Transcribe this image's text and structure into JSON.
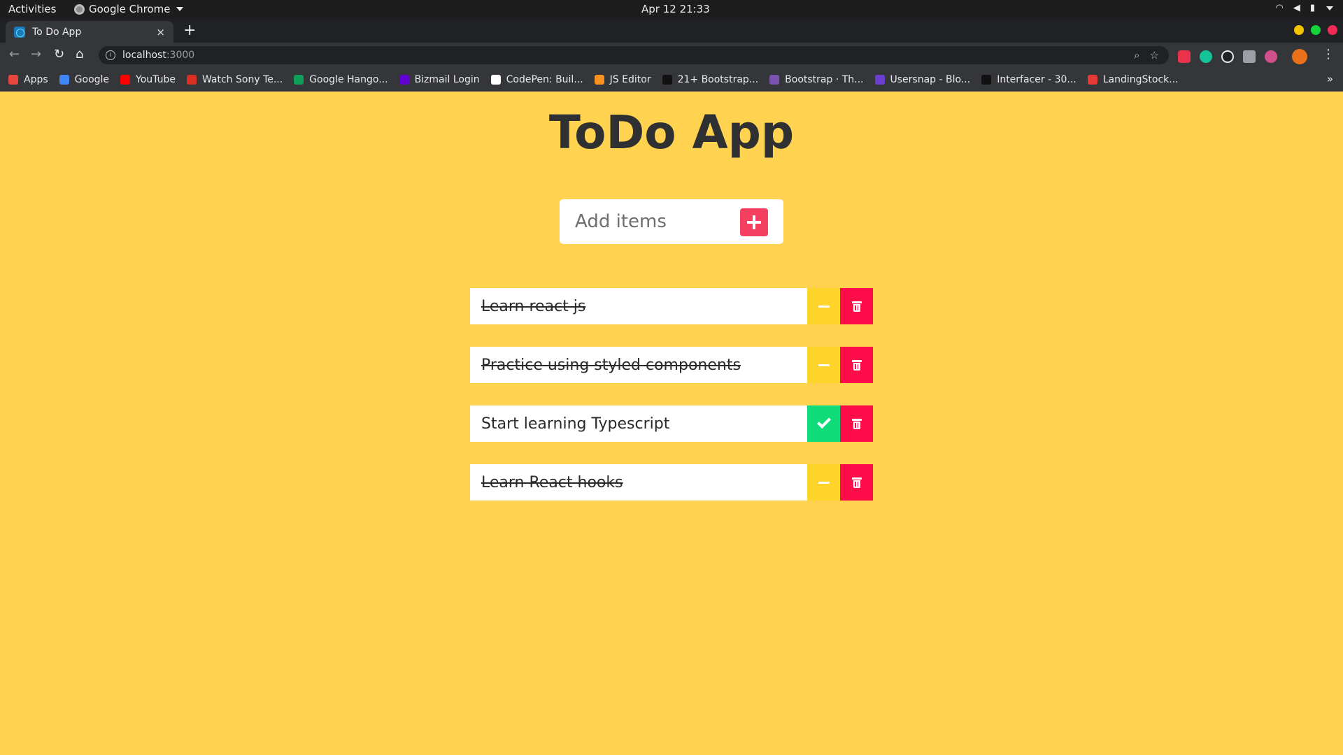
{
  "system_bar": {
    "activities": "Activities",
    "app_name": "Google Chrome",
    "clock": "Apr 12  21:33",
    "tray_icons": [
      "wifi-icon",
      "volume-icon",
      "battery-icon",
      "system-menu-caret-icon"
    ]
  },
  "browser": {
    "tab_title": "To Do App",
    "tab_close": "×",
    "new_tab": "+",
    "url_host": "localhost",
    "url_port": ":3000",
    "window_controls": {
      "minimize": "#f5c400",
      "maximize": "#16d33b",
      "close": "#f02c56"
    },
    "bookmarks": [
      {
        "label": "Apps",
        "color": "#e8453c"
      },
      {
        "label": "Google",
        "color": "#4285f4"
      },
      {
        "label": "YouTube",
        "color": "#ff0000"
      },
      {
        "label": "Watch Sony Te...",
        "color": "#d93025"
      },
      {
        "label": "Google Hango...",
        "color": "#0f9d58"
      },
      {
        "label": "Bizmail Login",
        "color": "#5f01d1"
      },
      {
        "label": "CodePen: Buil...",
        "color": "#ffffff"
      },
      {
        "label": "JS Editor",
        "color": "#f7931e"
      },
      {
        "label": "21+ Bootstrap...",
        "color": "#111111"
      },
      {
        "label": "Bootstrap · Th...",
        "color": "#7952b3"
      },
      {
        "label": "Usersnap - Blo...",
        "color": "#6c3fd1"
      },
      {
        "label": "Interfacer - 30...",
        "color": "#111111"
      },
      {
        "label": "LandingStock...",
        "color": "#e53935"
      }
    ],
    "bookmarks_more": "»"
  },
  "app": {
    "title": "ToDo App",
    "input_placeholder": "Add items",
    "accent": "#f43f61",
    "background": "#ffd24f",
    "todos": [
      {
        "text": "Learn react js",
        "completed": true
      },
      {
        "text": "Practice using styled components",
        "completed": true
      },
      {
        "text": "Start learning Typescript",
        "completed": false
      },
      {
        "text": "Learn React hooks",
        "completed": true
      }
    ]
  }
}
